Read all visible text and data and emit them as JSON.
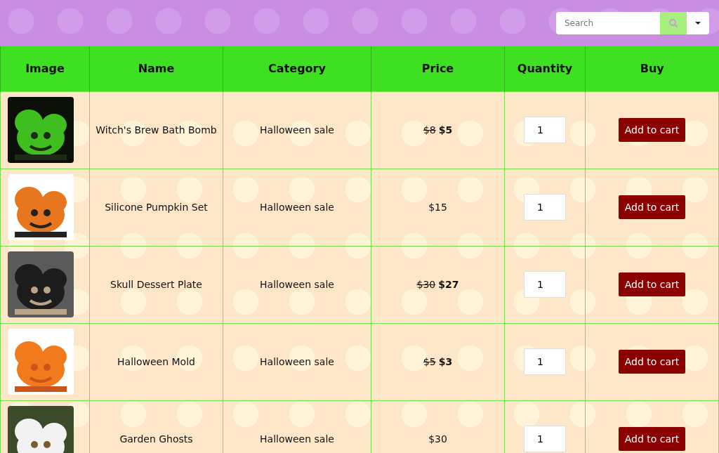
{
  "search": {
    "placeholder": "Search"
  },
  "table": {
    "columns": [
      "Image",
      "Name",
      "Category",
      "Price",
      "Quantity",
      "Buy"
    ],
    "rows": [
      {
        "name": "Witch's Brew Bath Bomb",
        "category": "Halloween sale",
        "old_price": "$8",
        "price": "$5",
        "quantity": "1",
        "button": "Add to cart"
      },
      {
        "name": "Silicone Pumpkin Set",
        "category": "Halloween sale",
        "price": "$15",
        "quantity": "1",
        "button": "Add to cart"
      },
      {
        "name": "Skull Dessert Plate",
        "category": "Halloween sale",
        "old_price": "$30",
        "price": "$27",
        "quantity": "1",
        "button": "Add to cart"
      },
      {
        "name": "Halloween Mold",
        "category": "Halloween sale",
        "old_price": "$5",
        "price": "$3",
        "quantity": "1",
        "button": "Add to cart"
      },
      {
        "name": "Garden Ghosts",
        "category": "Halloween sale",
        "price": "$30",
        "quantity": "1",
        "button": "Add to cart"
      }
    ]
  }
}
